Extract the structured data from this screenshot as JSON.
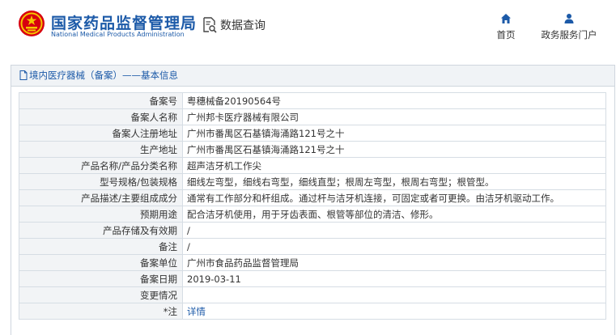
{
  "header": {
    "site_name_cn": "国家药品监督管理局",
    "site_name_en": "National Medical Products Administration",
    "query_label": "数据查询",
    "nav": [
      {
        "label": "首页",
        "icon": "home-icon"
      },
      {
        "label": "政务服务门户",
        "icon": "user-icon"
      }
    ]
  },
  "panel": {
    "breadcrumb": "境内医疗器械（备案）——基本信息",
    "rows": [
      {
        "key": "备案号",
        "value": "粤穗械备20190564号"
      },
      {
        "key": "备案人名称",
        "value": "广州邦卡医疗器械有限公司"
      },
      {
        "key": "备案人注册地址",
        "value": "广州市番禺区石基镇海涌路121号之十"
      },
      {
        "key": "生产地址",
        "value": "广州市番禺区石基镇海涌路121号之十"
      },
      {
        "key": "产品名称/产品分类名称",
        "value": "超声洁牙机工作尖"
      },
      {
        "key": "型号规格/包装规格",
        "value": "细线左弯型，细线右弯型，细线直型；根周左弯型，根周右弯型；根管型。"
      },
      {
        "key": "产品描述/主要组成成分",
        "value": "通常有工作部分和杆组成。通过杆与洁牙机连接，可固定或者可更换。由洁牙机驱动工作。"
      },
      {
        "key": "预期用途",
        "value": "配合洁牙机使用，用于牙齿表面、根管等部位的清洁、修形。"
      },
      {
        "key": "产品存储及有效期",
        "value": "/"
      },
      {
        "key": "备注",
        "value": "/"
      },
      {
        "key": "备案单位",
        "value": "广州市食品药品监督管理局"
      },
      {
        "key": "备案日期",
        "value": "2019-03-11"
      },
      {
        "key": "变更情况",
        "value": ""
      },
      {
        "key": "*注",
        "value": "详情"
      }
    ]
  },
  "colors": {
    "brand_blue": "#1c5aa8",
    "emblem_red": "#d7000f",
    "emblem_gold": "#f5c400"
  }
}
